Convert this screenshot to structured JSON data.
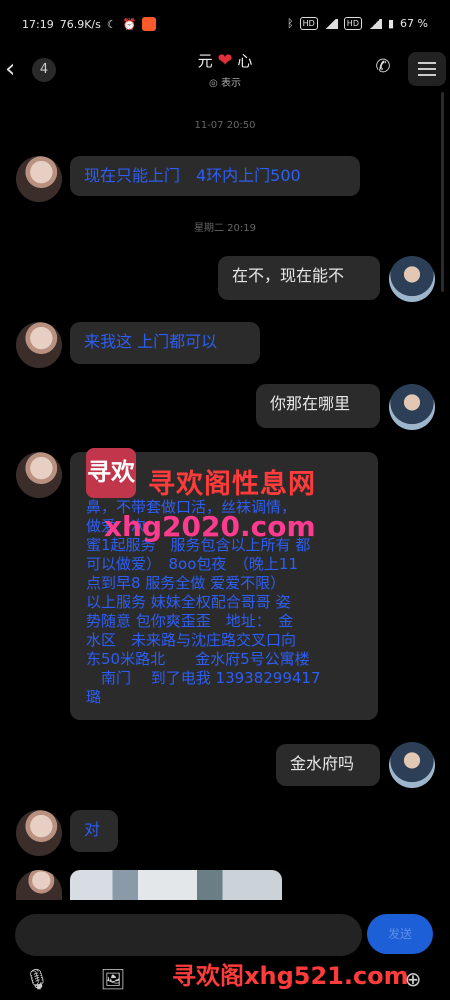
{
  "status_bar": {
    "time": "17:19",
    "speed": "76.9K/s",
    "icons_left": [
      "notification-icon",
      "moon-icon",
      "alarm-icon",
      "app-icon"
    ],
    "icons_right": [
      "bluetooth-icon",
      "hd-icon",
      "signal-icon",
      "hd-icon",
      "signal-icon",
      "battery-icon"
    ],
    "battery": "67 %"
  },
  "header": {
    "unread_count": "4",
    "contact_name_a": "元",
    "contact_name_b": "心",
    "contact_status": "表示"
  },
  "messages": [
    {
      "type": "timestamp",
      "text": "11-07 20:50"
    },
    {
      "type": "incoming",
      "text": "现在只能上门　4环内上门500"
    },
    {
      "type": "timestamp",
      "text": "星期二 20:19"
    },
    {
      "type": "outgoing",
      "text": "在不，现在能不"
    },
    {
      "type": "incoming",
      "text": "来我这 上门都可以"
    },
    {
      "type": "outgoing",
      "text": "你那在哪里"
    },
    {
      "type": "incoming_long",
      "lines": [
        "",
        "",
        "鼻，不带套做口活，丝袜调情，",
        "做爱　次",
        "蜜1起服务　服务包含以上所有 都",
        "可以做爱）　8oo包夜　（晚上11",
        "点到早8 服务全做 爱爱不限）",
        "以上服务 妹妹全权配合哥哥 姿",
        "势随意 包你爽歪歪　地址：　金",
        "水区　未来路与沈庄路交叉口向",
        "东50米路北　　金水府5号公寓楼",
        "　南门　 到了电我 13938299417",
        "璐"
      ]
    },
    {
      "type": "outgoing",
      "text": "金水府吗"
    },
    {
      "type": "incoming",
      "text": "对"
    }
  ],
  "watermark": {
    "logo": "寻欢",
    "title": "寻欢阁性息网",
    "url": "xhg2020.com",
    "bottom": "寻欢阁xhg521.com"
  },
  "input": {
    "placeholder": "",
    "send_label": "发送"
  },
  "toolbar": [
    "microphone-icon",
    "image-icon",
    "camera-icon",
    "emoji-icon",
    "plus-icon"
  ],
  "colors": {
    "incoming_text": "#2d5ef5",
    "bubble_bg": "#2b2b2b",
    "send_button": "#1d5fd6",
    "watermark": "#ff3b3b"
  }
}
